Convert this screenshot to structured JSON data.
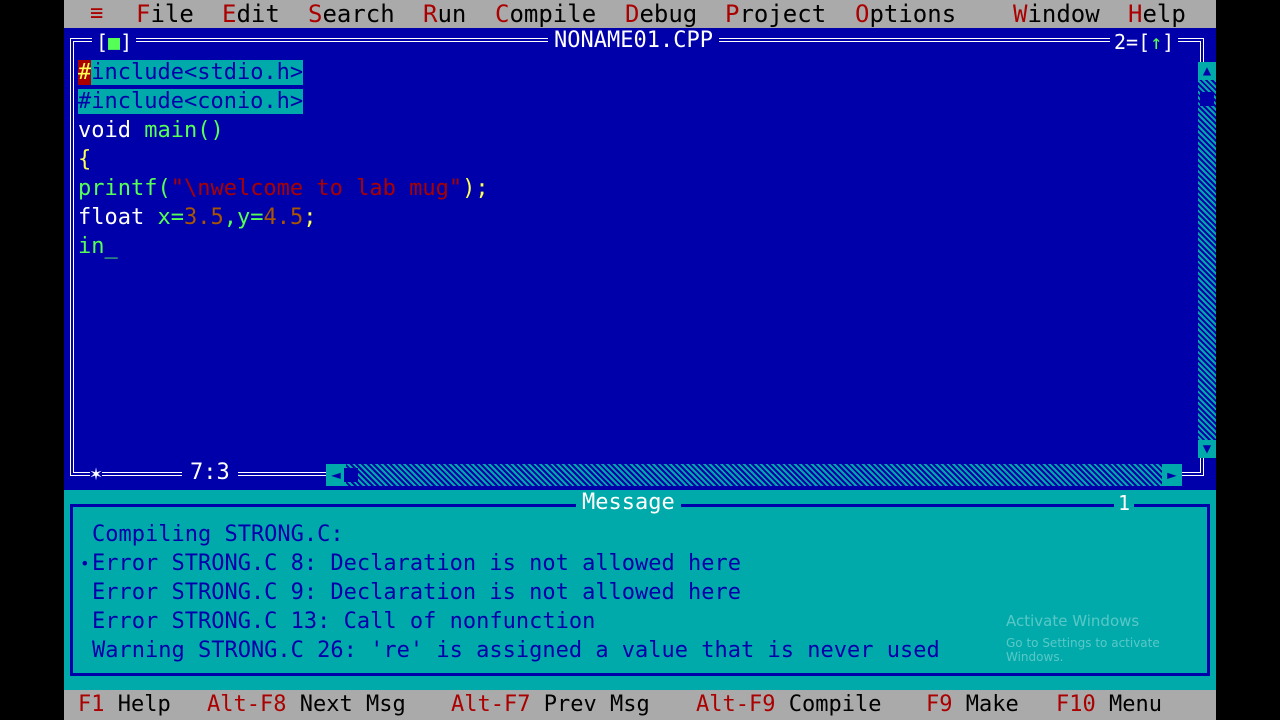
{
  "menubar": {
    "system_icon": "≡",
    "items": [
      {
        "hot": "F",
        "rest": "ile"
      },
      {
        "hot": "E",
        "rest": "dit"
      },
      {
        "hot": "S",
        "rest": "earch"
      },
      {
        "hot": "R",
        "rest": "un"
      },
      {
        "hot": "C",
        "rest": "ompile"
      },
      {
        "hot": "D",
        "rest": "ebug"
      },
      {
        "hot": "P",
        "rest": "roject"
      },
      {
        "hot": "O",
        "rest": "ptions"
      },
      {
        "hot": "W",
        "rest": "indow"
      },
      {
        "hot": "H",
        "rest": "elp"
      }
    ]
  },
  "editor": {
    "title": "NONAME01.CPP",
    "close_box": "[",
    "close_box_glyph": "■",
    "close_box_end": "]",
    "window_number": "2=[",
    "zoom_glyph": "↑",
    "window_number_end": "]",
    "cursor_position": "7:3",
    "resize_glyph": "✶",
    "code_lines": [
      {
        "a": "#",
        "b": "include<stdio.h>"
      },
      {
        "a": "#include<conio.h>"
      },
      {
        "a": "void",
        "b": " main()"
      },
      {
        "a": "{"
      },
      {
        "a": "printf(",
        "b": "\"\\nwelcome to lab mug\"",
        "c": ");"
      },
      {
        "a": "float",
        "b": " x=",
        "c": "3.5",
        "d": ",y=",
        "e": "4.5",
        "f": ";"
      },
      {
        "a": "in_"
      }
    ]
  },
  "message": {
    "title": "Message",
    "window_number": "1",
    "lines": [
      "Compiling STRONG.C:",
      "Error STRONG.C 8: Declaration is not allowed here",
      "Error STRONG.C 9: Declaration is not allowed here",
      "Error STRONG.C 13: Call of nonfunction",
      "Warning STRONG.C 26: 're' is assigned a value that is never used"
    ],
    "watermark_title": "Activate Windows",
    "watermark_sub": "Go to Settings to activate Windows."
  },
  "statusbar": {
    "items": [
      {
        "key": "F1",
        "label": " Help"
      },
      {
        "key": "Alt-F8",
        "label": " Next Msg"
      },
      {
        "key": "Alt-F7",
        "label": " Prev Msg"
      },
      {
        "key": "Alt-F9",
        "label": " Compile"
      },
      {
        "key": "F9",
        "label": " Make"
      },
      {
        "key": "F10",
        "label": " Menu"
      }
    ]
  },
  "colors": {
    "editor_bg": "#0000aa",
    "menu_bg": "#aaaaaa",
    "message_bg": "#00aaaa",
    "hotkey": "#aa0000"
  }
}
